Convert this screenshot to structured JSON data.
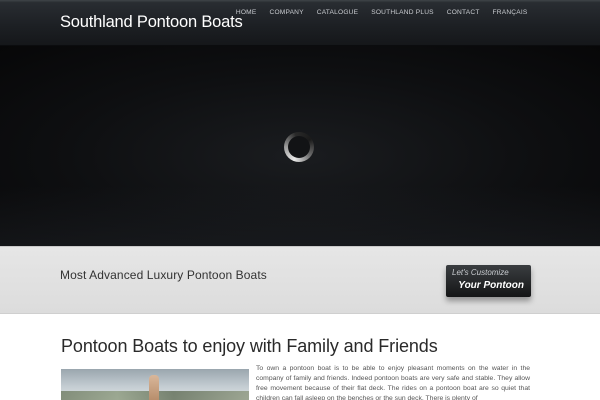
{
  "header": {
    "site_title": "Southland Pontoon Boats",
    "nav": [
      "HOME",
      "COMPANY",
      "CATALOGUE",
      "SOUTHLAND PLUS",
      "CONTACT",
      "FRANÇAIS"
    ]
  },
  "hero": {
    "loader_icon": "loading-spinner-icon"
  },
  "callout": {
    "text": "Most Advanced Luxury Pontoon Boats",
    "cta_line1": "Let's Customize",
    "cta_line2": "Your Pontoon"
  },
  "content": {
    "title": "Pontoon Boats to enjoy with Family and Friends",
    "body": "To own a pontoon boat is to be able to enjoy pleasant moments on the water in the company of family and friends. Indeed pontoon boats are very safe and stable. They allow free movement because of their flat deck. The rides on a pontoon boat are so quiet that children can fall asleep on the benches or the sun deck. There is plenty of"
  },
  "colors": {
    "header_bg": "#1c1f23",
    "hero_bg": "#0e0f11",
    "callout_bg": "#e2e2e2",
    "cta_bg": "#1f2123",
    "body_text": "#555555"
  }
}
